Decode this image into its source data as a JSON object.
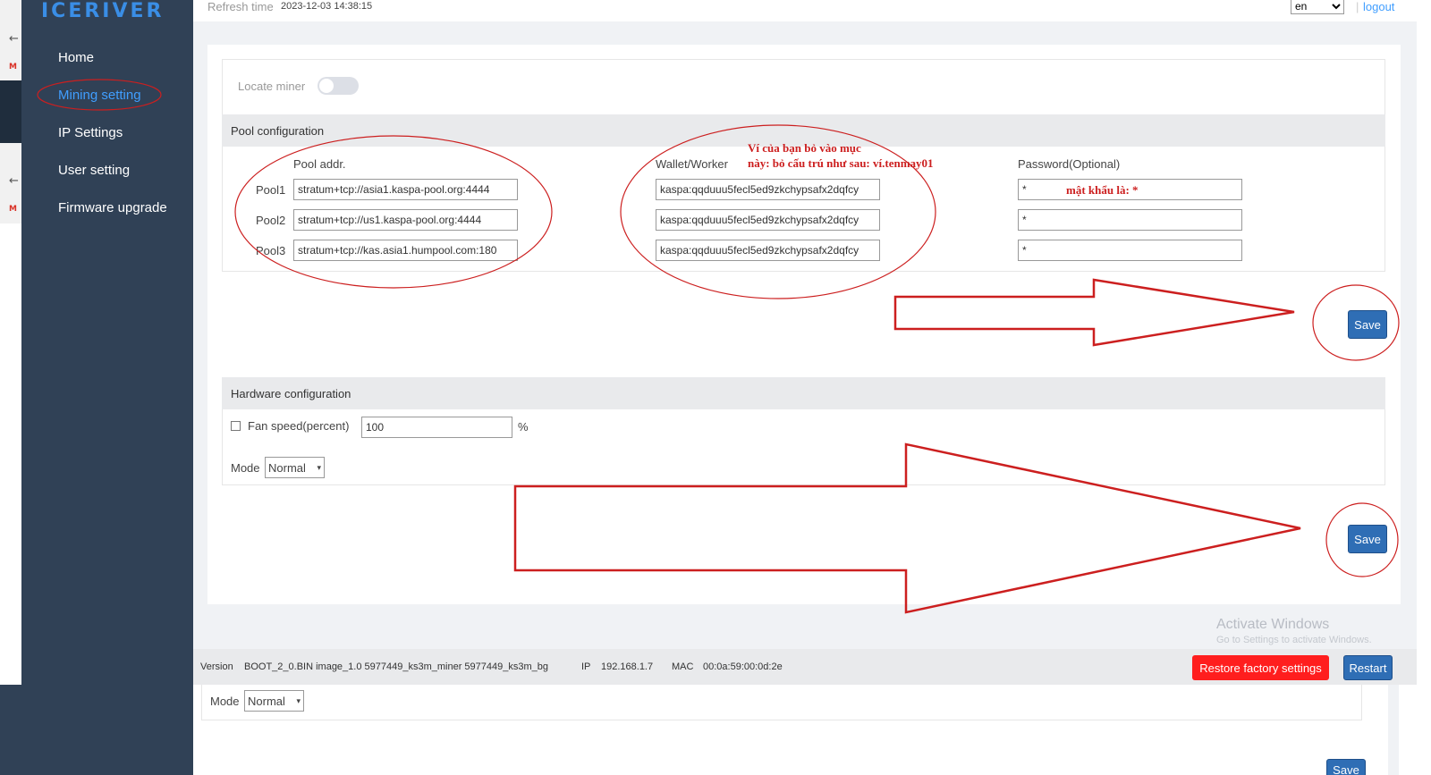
{
  "app": {
    "logo_text": "ICERIVER"
  },
  "sidebar": {
    "items": [
      {
        "label": "Home",
        "active": false
      },
      {
        "label": "Mining setting",
        "active": true
      },
      {
        "label": "IP Settings",
        "active": false
      },
      {
        "label": "User setting",
        "active": false
      },
      {
        "label": "Firmware upgrade",
        "active": false
      }
    ]
  },
  "topbar": {
    "refresh_label": "Refresh time",
    "refresh_time": "2023-12-03 14:38:15",
    "language": "en",
    "logout": "logout"
  },
  "locate": {
    "label": "Locate miner",
    "enabled": false
  },
  "pool_config": {
    "title": "Pool configuration",
    "col_pool": "Pool addr.",
    "col_wallet": "Wallet/Worker",
    "col_password": "Password(Optional)",
    "rows": [
      {
        "label": "Pool1",
        "addr": "stratum+tcp://asia1.kaspa-pool.org:4444",
        "wallet": "kaspa:qqduuu5fecl5ed9zkchypsafx2dqfcy",
        "password": "*"
      },
      {
        "label": "Pool2",
        "addr": "stratum+tcp://us1.kaspa-pool.org:4444",
        "wallet": "kaspa:qqduuu5fecl5ed9zkchypsafx2dqfcy",
        "password": "*"
      },
      {
        "label": "Pool3",
        "addr": "stratum+tcp://kas.asia1.humpool.com:180",
        "wallet": "kaspa:qqduuu5fecl5ed9zkchypsafx2dqfcy",
        "password": "*"
      }
    ],
    "save_label": "Save"
  },
  "hardware_config": {
    "title": "Hardware configuration",
    "fan_label": "Fan speed(percent)",
    "fan_value": "100",
    "fan_unit": "%",
    "mode_label": "Mode",
    "mode_value": "Normal",
    "save_label": "Save"
  },
  "footer": {
    "version_label": "Version",
    "version_value": "BOOT_2_0.BIN image_1.0 5977449_ks3m_miner 5977449_ks3m_bg",
    "ip_label": "IP",
    "ip_value": "192.168.1.7",
    "mac_label": "MAC",
    "mac_value": "00:0a:59:00:0d:2e",
    "restore_label": "Restore factory settings",
    "restart_label": "Restart"
  },
  "watermark": {
    "title": "Activate Windows",
    "subtitle": "Go to Settings to activate Windows."
  },
  "lower_copy": {
    "mode_label": "Mode",
    "mode_value": "Normal",
    "save_label": "Save"
  },
  "annotations": {
    "wallet_note_line1": "Ví của bạn bỏ vào  mục",
    "wallet_note_line2": "này: bỏ cấu trú như sau: ví.tenmay01",
    "password_note": "mật khẩu là:  *",
    "color": "#cc1f1f"
  },
  "colors": {
    "sidebar_bg": "#304156",
    "accent": "#409eff",
    "save_button": "#2f6eb5",
    "restore_button": "#ff1e1e"
  }
}
